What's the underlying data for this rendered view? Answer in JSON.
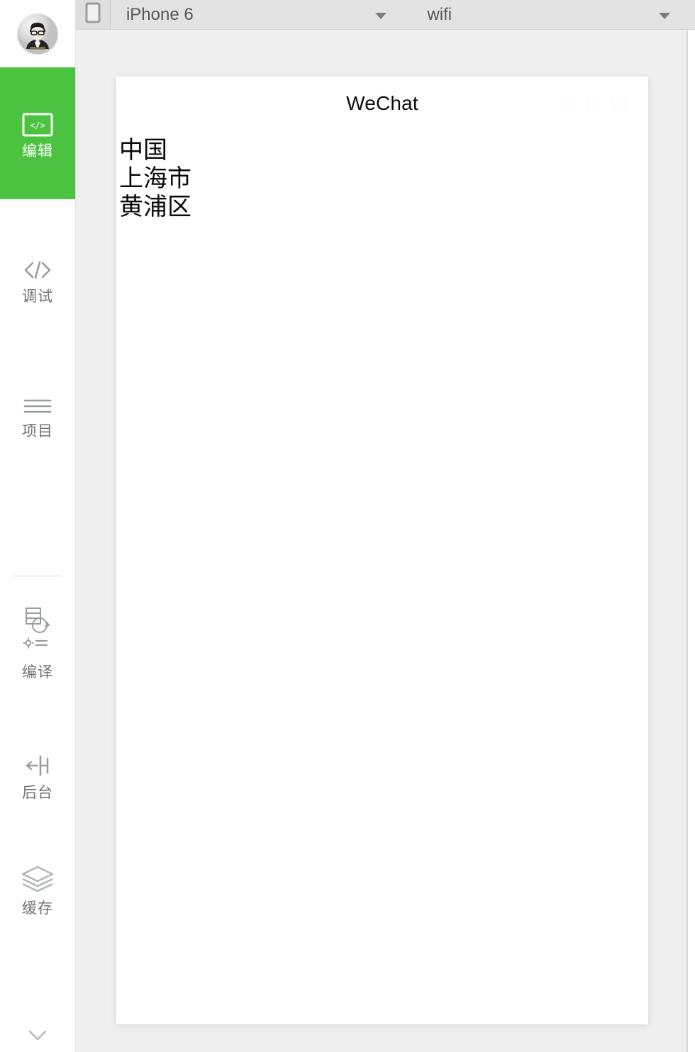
{
  "app": {
    "name": "wechat-devtools"
  },
  "sidebar": {
    "avatar": {
      "icon": "user-avatar",
      "alt": "user avatar"
    },
    "items": [
      {
        "id": "edit",
        "label": "编辑",
        "icon": "code-window-icon",
        "active": true
      },
      {
        "id": "debug",
        "label": "调试",
        "icon": "code-brackets-icon",
        "active": false
      },
      {
        "id": "project",
        "label": "项目",
        "icon": "list-lines-icon",
        "active": false
      },
      {
        "id": "compile",
        "label": "编译",
        "icon": "compile-refresh-icon",
        "active": false
      },
      {
        "id": "background",
        "label": "后台",
        "icon": "arrow-to-bar-icon",
        "active": false
      },
      {
        "id": "cache",
        "label": "缓存",
        "icon": "layers-icon",
        "active": false
      }
    ],
    "expand": {
      "icon": "chevron-down-icon",
      "label": ""
    }
  },
  "toolbar": {
    "device_icon": "phone-icon",
    "device_select": {
      "value": "iPhone 6",
      "caret": "caret-down-icon"
    },
    "network_select": {
      "value": "wifi",
      "caret": "caret-down-icon"
    }
  },
  "simulator": {
    "header": {
      "title": "WeChat",
      "capsule_dots": [
        "dot-1",
        "dot-2",
        "dot-3"
      ]
    },
    "content": {
      "lines": [
        "中国",
        "上海市",
        "黄浦区"
      ]
    }
  },
  "colors": {
    "accent_green": "#4cc340",
    "toolbar_bg": "#e3e3e3",
    "stage_bg": "#efefef",
    "sidebar_text": "#6f7275"
  }
}
